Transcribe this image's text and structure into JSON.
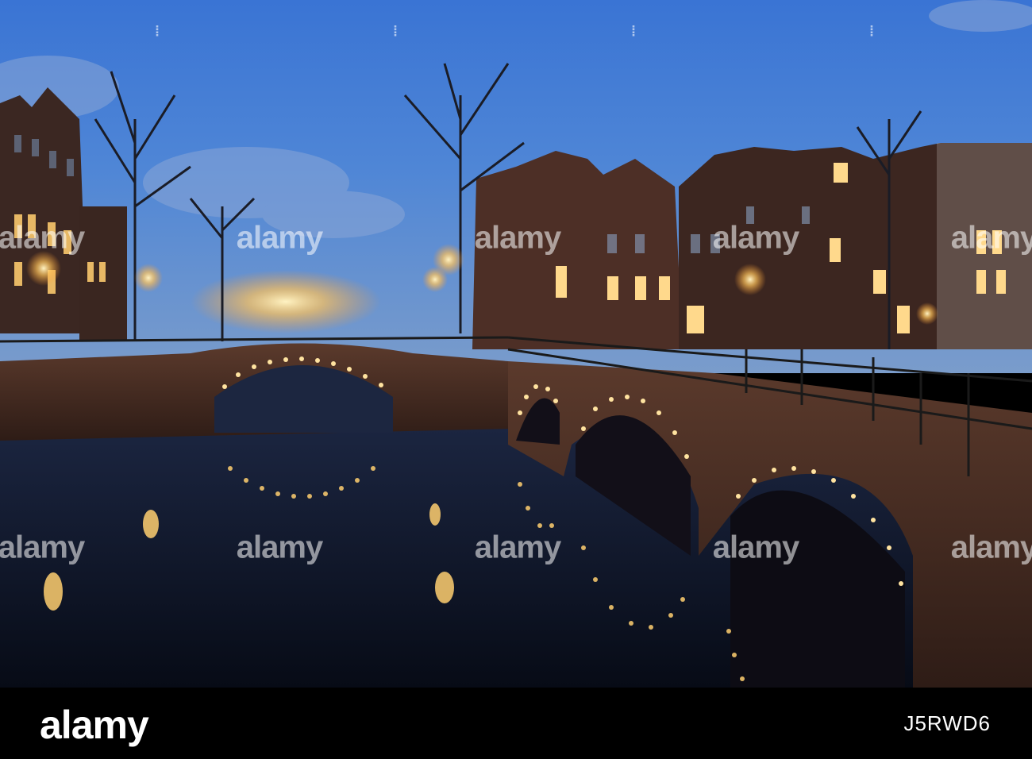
{
  "photo": {
    "description_colors": {
      "sky_top": "#3f78d6",
      "sky_horizon": "#6d93c9",
      "water": "#0c1428",
      "lamp_glow": "#ffd27a",
      "brick": "#4a2d23"
    }
  },
  "watermark": {
    "word": "alamy",
    "rows": [
      {
        "words": 4,
        "dots": 7
      },
      {
        "words": 4,
        "dots": 7
      },
      {
        "words": 4,
        "dots": 7
      },
      {
        "words": 4,
        "dots": 7
      }
    ]
  },
  "footer": {
    "logo": "alamy",
    "stock_id": "J5RWD6",
    "background": "#000000"
  }
}
